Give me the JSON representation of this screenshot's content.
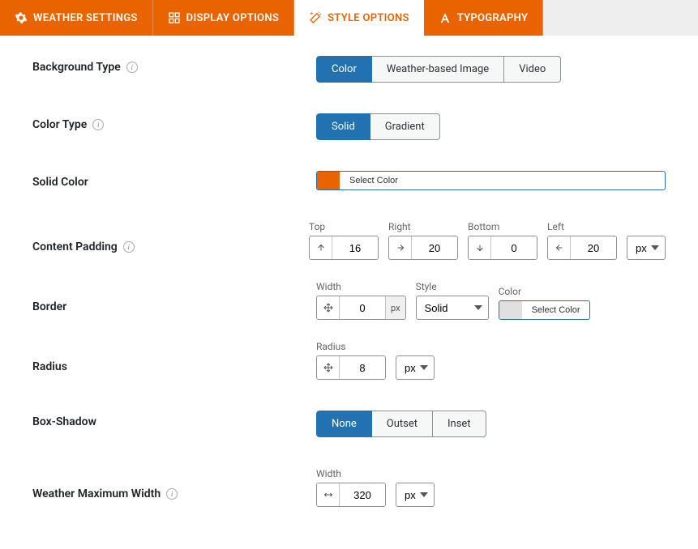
{
  "tabs": {
    "weather": "WEATHER SETTINGS",
    "display": "DISPLAY OPTIONS",
    "style": "STYLE OPTIONS",
    "typography": "TYPOGRAPHY"
  },
  "labels": {
    "bgType": "Background Type",
    "colorType": "Color Type",
    "solidColor": "Solid Color",
    "contentPadding": "Content Padding",
    "border": "Border",
    "radius": "Radius",
    "boxShadow": "Box-Shadow",
    "maxWidth": "Weather Maximum Width"
  },
  "fieldLabels": {
    "top": "Top",
    "right": "Right",
    "bottom": "Bottom",
    "left": "Left",
    "width": "Width",
    "style": "Style",
    "color": "Color",
    "radius": "Radius"
  },
  "options": {
    "bg": {
      "color": "Color",
      "weather": "Weather-based Image",
      "video": "Video"
    },
    "colorType": {
      "solid": "Solid",
      "gradient": "Gradient"
    },
    "shadow": {
      "none": "None",
      "outset": "Outset",
      "inset": "Inset"
    },
    "borderStyle": "Solid",
    "unitPx": "px",
    "selectColor": "Select Color"
  },
  "values": {
    "padTop": "16",
    "padRight": "20",
    "padBottom": "0",
    "padLeft": "20",
    "borderWidth": "0",
    "radius": "8",
    "maxWidth": "320"
  },
  "colors": {
    "solid": "#e96400",
    "border": "#e0e0e0"
  }
}
